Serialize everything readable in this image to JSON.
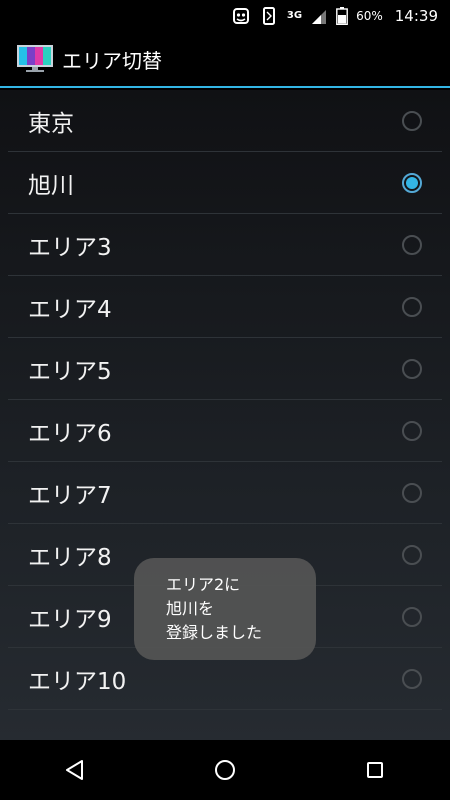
{
  "status_bar": {
    "network": "3G",
    "battery": "60%",
    "time": "14:39"
  },
  "action_bar": {
    "title": "エリア切替",
    "icon": "tv-monitor-icon"
  },
  "areas": [
    {
      "label": "東京",
      "selected": false
    },
    {
      "label": "旭川",
      "selected": true
    },
    {
      "label": "エリア3",
      "selected": false
    },
    {
      "label": "エリア4",
      "selected": false
    },
    {
      "label": "エリア5",
      "selected": false
    },
    {
      "label": "エリア6",
      "selected": false
    },
    {
      "label": "エリア7",
      "selected": false
    },
    {
      "label": "エリア8",
      "selected": false
    },
    {
      "label": "エリア9",
      "selected": false
    },
    {
      "label": "エリア10",
      "selected": false
    }
  ],
  "toast": {
    "lines": [
      "エリア2に",
      "旭川を",
      "登録しました"
    ]
  },
  "colors": {
    "accent": "#33b5e5",
    "divider": "#2e3338",
    "toast_bg": "#555555"
  }
}
